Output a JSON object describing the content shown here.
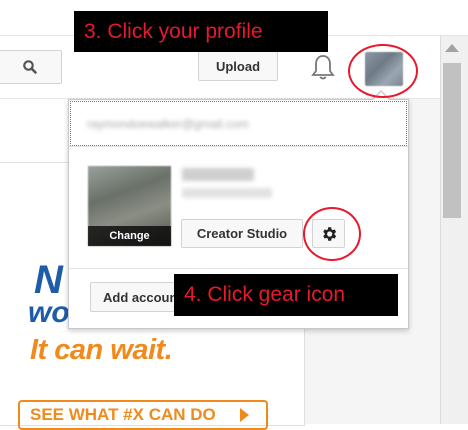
{
  "header": {
    "upload_label": "Upload"
  },
  "account_menu": {
    "email": "raymondoewalker@gmail.com",
    "change_label": "Change",
    "creator_studio_label": "Creator Studio",
    "add_account_label": "Add account"
  },
  "annotations": {
    "step3": "3. Click your profile",
    "step4": "4. Click gear icon"
  },
  "ad": {
    "logo_top": "N",
    "logo_mid": "wo",
    "tagline": "It can wait.",
    "cta": "SEE WHAT #X CAN DO"
  },
  "colors": {
    "annotation_red": "#e8192c",
    "ad_blue": "#1f5ca8",
    "ad_orange": "#f08a1c"
  }
}
